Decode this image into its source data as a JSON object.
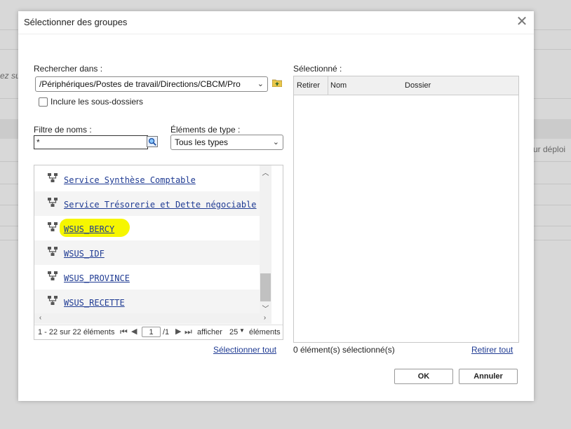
{
  "dialog": {
    "title": "Sélectionner des groupes"
  },
  "search": {
    "label": "Rechercher dans :",
    "path": "/Périphériques/Postes de travail/Directions/CBCM/Pro",
    "include_subfolders_label": "Inclure les sous-dossiers",
    "include_subfolders_checked": false
  },
  "filter": {
    "label": "Filtre de noms :",
    "value": "*"
  },
  "type_filter": {
    "label": "Éléments de type :",
    "selected": "Tous les types"
  },
  "results": {
    "items": [
      {
        "label": "Service Synthèse Comptable"
      },
      {
        "label": "Service Trésorerie et Dette négociable"
      },
      {
        "label": "WSUS_BERCY",
        "highlighted": true
      },
      {
        "label": "WSUS_IDF"
      },
      {
        "label": "WSUS_PROVINCE"
      },
      {
        "label": "WSUS_RECETTE"
      }
    ],
    "pager": {
      "range": "1 - 22 sur 22 éléments",
      "page": "1",
      "total_pages": "/1",
      "show_label": "afficher",
      "per_page": "25",
      "elements_label": "éléments"
    },
    "select_all": "Sélectionner tout"
  },
  "selected": {
    "label": "Sélectionné :",
    "columns": [
      "Retirer",
      "Nom",
      "Dossier"
    ],
    "count_text": "0 élément(s) sélectionné(s)",
    "remove_all": "Retirer tout"
  },
  "buttons": {
    "ok": "OK",
    "cancel": "Annuler"
  },
  "background": {
    "left_fragment": "ez su",
    "right_fragment": "ur déploi"
  },
  "colors": {
    "link": "#1f3b93",
    "highlight": "#f6f600"
  }
}
